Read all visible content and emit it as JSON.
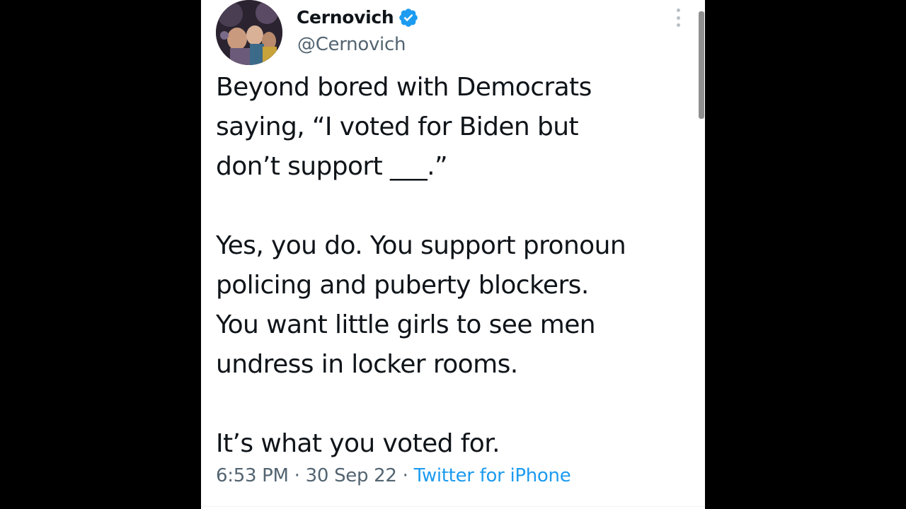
{
  "tweet": {
    "author": {
      "display_name": "Cernovich",
      "handle": "@Cernovich",
      "verified": true,
      "verified_color": "#1d9bf0"
    },
    "body_paragraphs": [
      [
        "Beyond bored with Democrats",
        "saying, “I voted for Biden but",
        "don’t support ___.”"
      ],
      [
        "Yes, you do. You support pronoun",
        "policing and puberty blockers.",
        "You want little girls to see men",
        "undress in locker rooms."
      ],
      [
        "It’s what you voted for."
      ]
    ],
    "meta": {
      "time": "6:53 PM",
      "date": "30 Sep 22",
      "separator": "·",
      "source": "Twitter for iPhone",
      "source_color": "#1d9bf0"
    },
    "icons": {
      "verified": "verified-badge-icon",
      "more": "more-options-icon"
    }
  },
  "colors": {
    "background": "#000000",
    "card": "#ffffff",
    "text": "#0f1419",
    "secondary_text": "#536471"
  }
}
